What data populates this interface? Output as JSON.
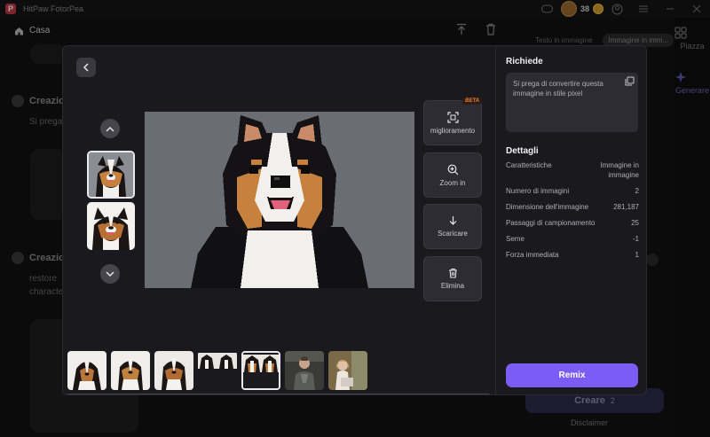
{
  "app": {
    "title": "HitPaw FotorPea",
    "credits": "38"
  },
  "nav": {
    "home_label": "Casa"
  },
  "background": {
    "tabs": [
      "Testo in immagine",
      "Immagine in imm..."
    ],
    "feed": [
      {
        "label": "Creazio",
        "text": "Si prega"
      },
      {
        "label": "Creazio",
        "text_lines": [
          "restore",
          "characte"
        ]
      }
    ],
    "rail": [
      {
        "label": "Piazza",
        "icon": "grid-icon"
      },
      {
        "label": "Generare",
        "icon": "sparkle-icon"
      }
    ],
    "create_button": {
      "label": "Creare",
      "count": "2"
    },
    "disclaimer": "Disclaimer"
  },
  "modal": {
    "actions": [
      {
        "label": "miglioramento",
        "icon": "enhance-icon",
        "badge": "BETA"
      },
      {
        "label": "Zoom in",
        "icon": "zoom-in-icon"
      },
      {
        "label": "Scaricare",
        "icon": "download-icon"
      },
      {
        "label": "Elimina",
        "icon": "trash-icon"
      }
    ],
    "prompt_title": "Richiede",
    "prompt_text": "Si prega di convertire questa immagine in stile pixel",
    "details_title": "Dettagli",
    "details": [
      {
        "key": "Caratteristiche",
        "value": "Immagine in immagine"
      },
      {
        "key": "Numero di immagini",
        "value": "2"
      },
      {
        "key": "Dimensione dell'immagine",
        "value": "281,187"
      },
      {
        "key": "Passaggi di campionamento",
        "value": "25"
      },
      {
        "key": "Seme",
        "value": "-1"
      },
      {
        "key": "Forza immediata",
        "value": "1"
      }
    ],
    "remix_label": "Remix"
  },
  "colors": {
    "accent": "#7b5cf5",
    "beta": "#ef7a3a",
    "modal_bg": "#1a191d",
    "page_bg": "#121212"
  }
}
